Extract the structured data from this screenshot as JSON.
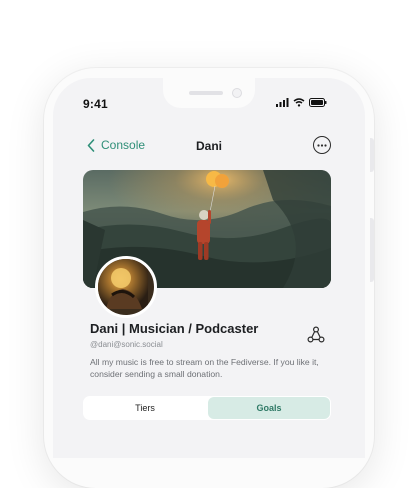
{
  "status_bar": {
    "time": "9:41"
  },
  "header": {
    "back_label": "Console",
    "title": "Dani"
  },
  "profile": {
    "name": "Dani | Musician / Podcaster",
    "handle": "@dani@sonic.social",
    "bio": "All my music is free to stream on the Fediverse. If you like it, consider sending a small donation."
  },
  "tabs": [
    {
      "label": "Tiers",
      "selected": false
    },
    {
      "label": "Goals",
      "selected": true
    }
  ],
  "colors": {
    "accent": "#2f8f78",
    "tab_selected_bg": "#d7ebe5"
  },
  "icons": {
    "back": "chevron-left-icon",
    "more": "more-horizontal-icon",
    "share": "share-icon"
  }
}
